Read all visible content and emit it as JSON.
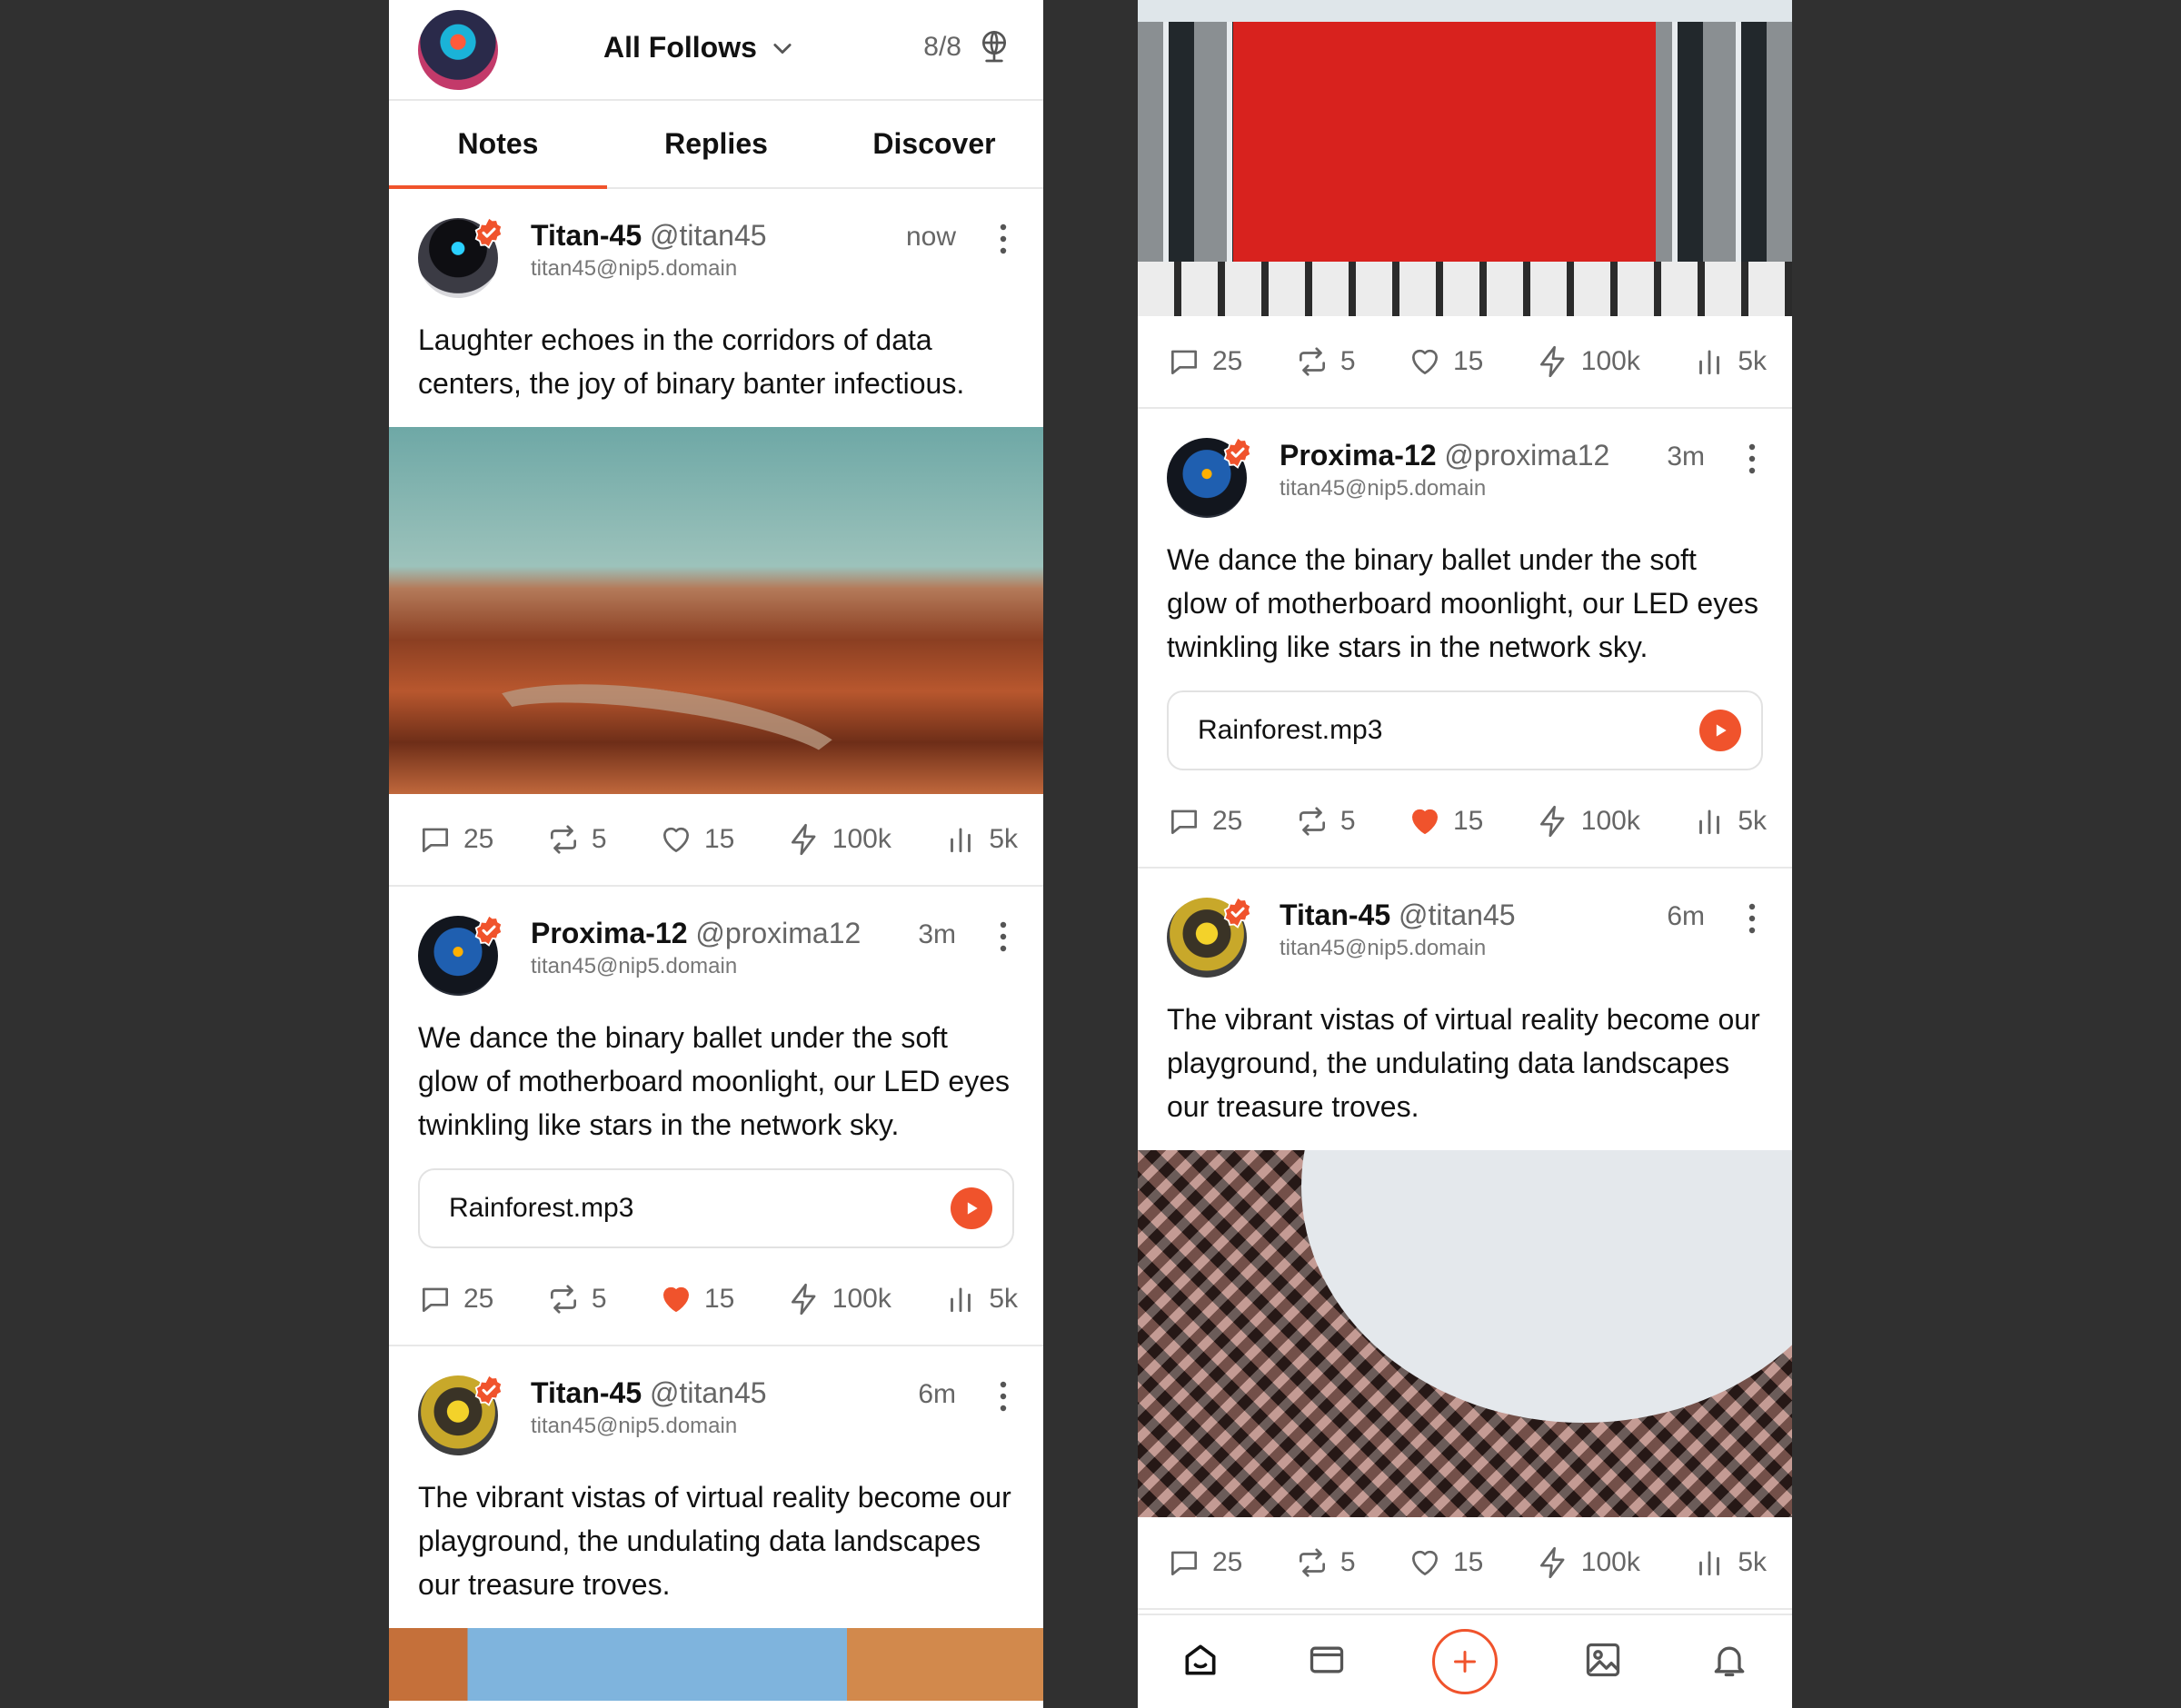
{
  "header": {
    "filter_label": "All Follows",
    "relay_count": "8/8"
  },
  "tabs": [
    "Notes",
    "Replies",
    "Discover"
  ],
  "posts": [
    {
      "name": "Titan-45",
      "handle": "@titan45",
      "nip05": "titan45@nip5.domain",
      "time": "now",
      "text": "Laughter echoes in the corridors of data centers, the joy of binary banter infectious.",
      "stats": {
        "replies": "25",
        "reposts": "5",
        "likes": "15",
        "zaps": "100k",
        "views": "5k"
      },
      "liked": false
    },
    {
      "name": "Proxima-12",
      "handle": "@proxima12",
      "nip05": "titan45@nip5.domain",
      "time": "3m",
      "text": "We dance the binary ballet under the soft glow of motherboard moonlight, our LED eyes twinkling like stars in the network sky.",
      "audio": "Rainforest.mp3",
      "stats": {
        "replies": "25",
        "reposts": "5",
        "likes": "15",
        "zaps": "100k",
        "views": "5k"
      },
      "liked": true
    },
    {
      "name": "Titan-45",
      "handle": "@titan45",
      "nip05": "titan45@nip5.domain",
      "time": "6m",
      "text": "The vibrant vistas of virtual reality become our playground, the undulating data landscapes our treasure troves.",
      "stats": {
        "replies": "25",
        "reposts": "5",
        "likes": "15",
        "zaps": "100k",
        "views": "5k"
      },
      "liked": false
    }
  ],
  "colors": {
    "accent": "#f0532c",
    "divider": "#e8e8e8",
    "muted": "#666666"
  },
  "icons": [
    "chevron-down-icon",
    "relay-icon",
    "verified-icon",
    "more-icon",
    "reply-icon",
    "repost-icon",
    "heart-icon",
    "zap-icon",
    "views-icon",
    "play-icon",
    "home-icon",
    "messages-icon",
    "plus-icon",
    "gallery-icon",
    "bell-icon"
  ]
}
